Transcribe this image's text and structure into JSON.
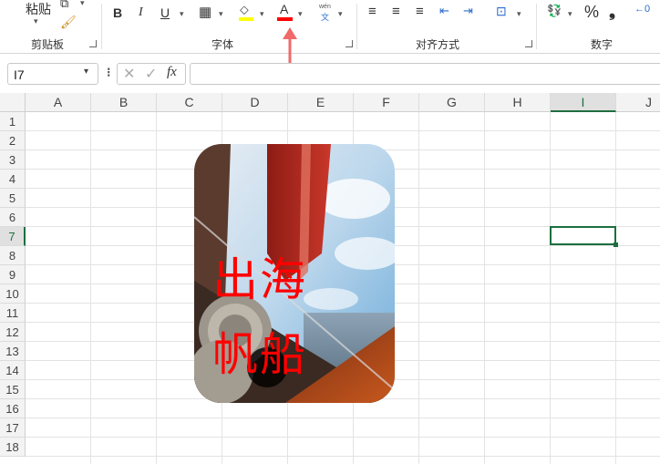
{
  "ribbon": {
    "paste_label": "粘贴",
    "groups": {
      "clipboard": "剪贴板",
      "font": "字体",
      "alignment": "对齐方式",
      "number": "数字"
    },
    "bold": "B",
    "italic": "I",
    "underline": "U",
    "font_color_glyph": "A",
    "percent_glyph": "%",
    "comma_glyph": "❟",
    "phonetic_top": "wén",
    "phonetic_bottom": "文",
    "decimal_glyph": "←0",
    "font_color": "#ff0000",
    "fill_color": "#ffff00"
  },
  "formula_bar": {
    "name_box": "I7",
    "fx": "fx",
    "content": ""
  },
  "columns": [
    "A",
    "B",
    "C",
    "D",
    "E",
    "F",
    "G",
    "H",
    "I",
    "J"
  ],
  "rows": [
    "1",
    "2",
    "3",
    "4",
    "5",
    "6",
    "7",
    "8",
    "9",
    "10",
    "11",
    "12",
    "13",
    "14",
    "15",
    "16",
    "17",
    "18"
  ],
  "active_cell": "I7",
  "image": {
    "text_line1": "出海",
    "text_line2": "帆船",
    "text_color": "#ff0000"
  },
  "annotation_arrow_color": "#f06a6a"
}
